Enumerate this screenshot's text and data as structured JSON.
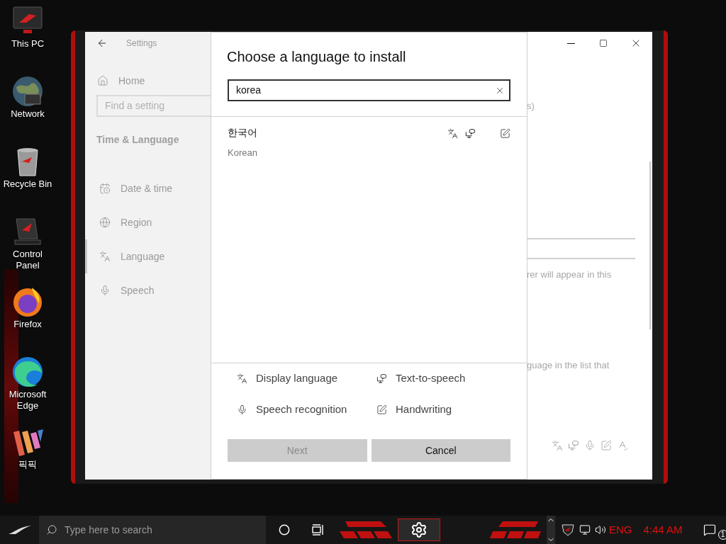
{
  "desktop_icons": [
    {
      "label": "This PC",
      "kind": "pc"
    },
    {
      "label": "Network",
      "kind": "globe"
    },
    {
      "label": "Recycle Bin",
      "kind": "bin"
    },
    {
      "label": "Control Panel",
      "kind": "panel"
    },
    {
      "label": "Firefox",
      "kind": "firefox"
    },
    {
      "label": "Microsoft Edge",
      "kind": "edge"
    },
    {
      "label": "픽픽",
      "kind": "picpick"
    }
  ],
  "settings": {
    "title": "Settings",
    "home": "Home",
    "search": {
      "placeholder": "Find a setting"
    },
    "section": "Time & Language",
    "nav": [
      {
        "label": "Date & time",
        "kind": "calendar",
        "selected": false
      },
      {
        "label": "Region",
        "kind": "globe",
        "selected": false
      },
      {
        "label": "Language",
        "kind": "language",
        "selected": true
      },
      {
        "label": "Speech",
        "kind": "mic",
        "selected": false
      }
    ],
    "background_texts": [
      "s)",
      "rer will appear in this",
      "guage in the list that"
    ],
    "background_features": [
      {
        "kind": "display"
      },
      {
        "kind": "tts"
      },
      {
        "kind": "mic"
      },
      {
        "kind": "handwriting"
      },
      {
        "kind": "spelling"
      }
    ]
  },
  "dialog": {
    "title": "Choose a language to install",
    "search": {
      "value": "korea"
    },
    "results": [
      {
        "native": "한국어",
        "english": "Korean",
        "features": [
          {
            "kind": "display"
          },
          {
            "kind": "tts"
          },
          {
            "kind": "handwriting"
          }
        ]
      }
    ],
    "legend": [
      {
        "kind": "display",
        "label": "Display language"
      },
      {
        "kind": "tts",
        "label": "Text-to-speech"
      },
      {
        "kind": "mic",
        "label": "Speech recognition"
      },
      {
        "kind": "handwriting",
        "label": "Handwriting"
      }
    ],
    "buttons": [
      {
        "label": "Next",
        "disabled": true
      },
      {
        "label": "Cancel",
        "disabled": false
      }
    ]
  },
  "taskbar": {
    "search": {
      "placeholder": "Type here to search"
    },
    "language": "ENG",
    "time": "4:44 AM",
    "notifications": "1"
  }
}
